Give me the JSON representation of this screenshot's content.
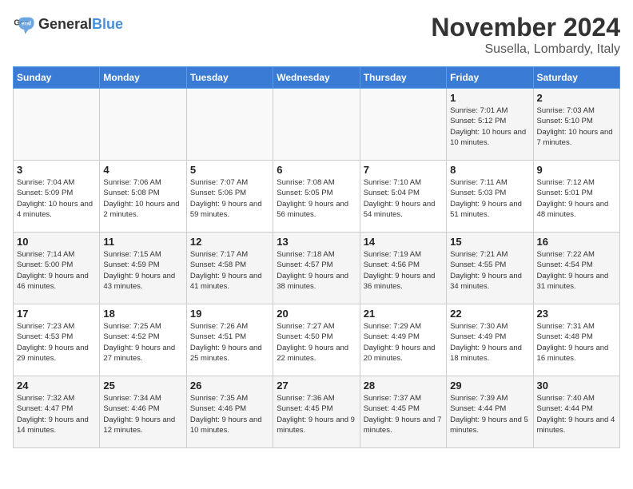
{
  "header": {
    "logo_general": "General",
    "logo_blue": "Blue",
    "month_year": "November 2024",
    "location": "Susella, Lombardy, Italy"
  },
  "days_of_week": [
    "Sunday",
    "Monday",
    "Tuesday",
    "Wednesday",
    "Thursday",
    "Friday",
    "Saturday"
  ],
  "weeks": [
    [
      {
        "day": "",
        "info": ""
      },
      {
        "day": "",
        "info": ""
      },
      {
        "day": "",
        "info": ""
      },
      {
        "day": "",
        "info": ""
      },
      {
        "day": "",
        "info": ""
      },
      {
        "day": "1",
        "info": "Sunrise: 7:01 AM\nSunset: 5:12 PM\nDaylight: 10 hours and 10 minutes."
      },
      {
        "day": "2",
        "info": "Sunrise: 7:03 AM\nSunset: 5:10 PM\nDaylight: 10 hours and 7 minutes."
      }
    ],
    [
      {
        "day": "3",
        "info": "Sunrise: 7:04 AM\nSunset: 5:09 PM\nDaylight: 10 hours and 4 minutes."
      },
      {
        "day": "4",
        "info": "Sunrise: 7:06 AM\nSunset: 5:08 PM\nDaylight: 10 hours and 2 minutes."
      },
      {
        "day": "5",
        "info": "Sunrise: 7:07 AM\nSunset: 5:06 PM\nDaylight: 9 hours and 59 minutes."
      },
      {
        "day": "6",
        "info": "Sunrise: 7:08 AM\nSunset: 5:05 PM\nDaylight: 9 hours and 56 minutes."
      },
      {
        "day": "7",
        "info": "Sunrise: 7:10 AM\nSunset: 5:04 PM\nDaylight: 9 hours and 54 minutes."
      },
      {
        "day": "8",
        "info": "Sunrise: 7:11 AM\nSunset: 5:03 PM\nDaylight: 9 hours and 51 minutes."
      },
      {
        "day": "9",
        "info": "Sunrise: 7:12 AM\nSunset: 5:01 PM\nDaylight: 9 hours and 48 minutes."
      }
    ],
    [
      {
        "day": "10",
        "info": "Sunrise: 7:14 AM\nSunset: 5:00 PM\nDaylight: 9 hours and 46 minutes."
      },
      {
        "day": "11",
        "info": "Sunrise: 7:15 AM\nSunset: 4:59 PM\nDaylight: 9 hours and 43 minutes."
      },
      {
        "day": "12",
        "info": "Sunrise: 7:17 AM\nSunset: 4:58 PM\nDaylight: 9 hours and 41 minutes."
      },
      {
        "day": "13",
        "info": "Sunrise: 7:18 AM\nSunset: 4:57 PM\nDaylight: 9 hours and 38 minutes."
      },
      {
        "day": "14",
        "info": "Sunrise: 7:19 AM\nSunset: 4:56 PM\nDaylight: 9 hours and 36 minutes."
      },
      {
        "day": "15",
        "info": "Sunrise: 7:21 AM\nSunset: 4:55 PM\nDaylight: 9 hours and 34 minutes."
      },
      {
        "day": "16",
        "info": "Sunrise: 7:22 AM\nSunset: 4:54 PM\nDaylight: 9 hours and 31 minutes."
      }
    ],
    [
      {
        "day": "17",
        "info": "Sunrise: 7:23 AM\nSunset: 4:53 PM\nDaylight: 9 hours and 29 minutes."
      },
      {
        "day": "18",
        "info": "Sunrise: 7:25 AM\nSunset: 4:52 PM\nDaylight: 9 hours and 27 minutes."
      },
      {
        "day": "19",
        "info": "Sunrise: 7:26 AM\nSunset: 4:51 PM\nDaylight: 9 hours and 25 minutes."
      },
      {
        "day": "20",
        "info": "Sunrise: 7:27 AM\nSunset: 4:50 PM\nDaylight: 9 hours and 22 minutes."
      },
      {
        "day": "21",
        "info": "Sunrise: 7:29 AM\nSunset: 4:49 PM\nDaylight: 9 hours and 20 minutes."
      },
      {
        "day": "22",
        "info": "Sunrise: 7:30 AM\nSunset: 4:49 PM\nDaylight: 9 hours and 18 minutes."
      },
      {
        "day": "23",
        "info": "Sunrise: 7:31 AM\nSunset: 4:48 PM\nDaylight: 9 hours and 16 minutes."
      }
    ],
    [
      {
        "day": "24",
        "info": "Sunrise: 7:32 AM\nSunset: 4:47 PM\nDaylight: 9 hours and 14 minutes."
      },
      {
        "day": "25",
        "info": "Sunrise: 7:34 AM\nSunset: 4:46 PM\nDaylight: 9 hours and 12 minutes."
      },
      {
        "day": "26",
        "info": "Sunrise: 7:35 AM\nSunset: 4:46 PM\nDaylight: 9 hours and 10 minutes."
      },
      {
        "day": "27",
        "info": "Sunrise: 7:36 AM\nSunset: 4:45 PM\nDaylight: 9 hours and 9 minutes."
      },
      {
        "day": "28",
        "info": "Sunrise: 7:37 AM\nSunset: 4:45 PM\nDaylight: 9 hours and 7 minutes."
      },
      {
        "day": "29",
        "info": "Sunrise: 7:39 AM\nSunset: 4:44 PM\nDaylight: 9 hours and 5 minutes."
      },
      {
        "day": "30",
        "info": "Sunrise: 7:40 AM\nSunset: 4:44 PM\nDaylight: 9 hours and 4 minutes."
      }
    ]
  ]
}
